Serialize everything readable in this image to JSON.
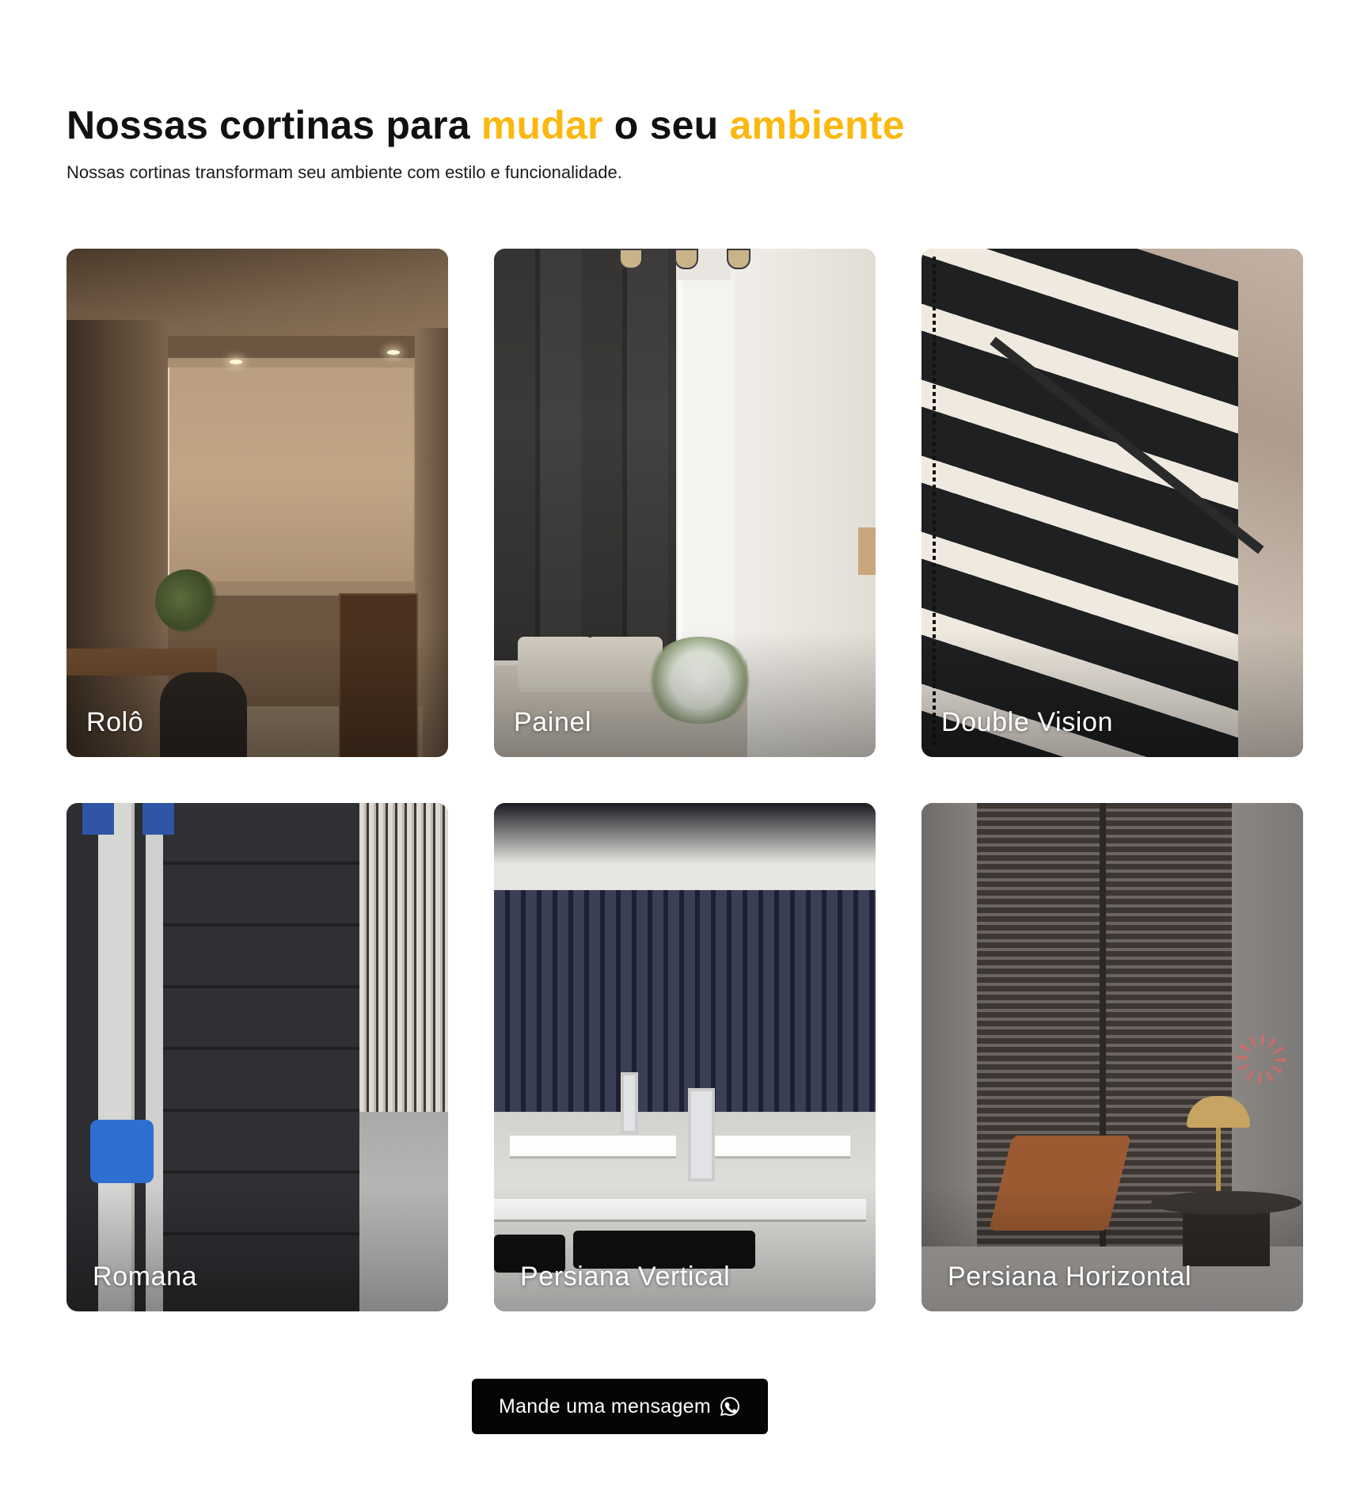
{
  "header": {
    "title_part1": "Nossas cortinas para ",
    "title_accent1": "mudar",
    "title_part2": " o seu ",
    "title_accent2": "ambiente",
    "subtitle": "Nossas cortinas transformam seu ambiente com estilo e funcionalidade."
  },
  "colors": {
    "accent": "#fbb80f",
    "text": "#111111",
    "button_bg": "#050505",
    "button_text": "#ffffff"
  },
  "products": [
    {
      "label": "Rolô",
      "image": "rolo-photo"
    },
    {
      "label": "Painel",
      "image": "painel-photo"
    },
    {
      "label": "Double Vision",
      "image": "double-vision-photo"
    },
    {
      "label": "Romana",
      "image": "romana-photo"
    },
    {
      "label": "Persiana Vertical",
      "image": "persiana-vertical-photo"
    },
    {
      "label": "Persiana Horizontal",
      "image": "persiana-horizontal-photo"
    }
  ],
  "cta": {
    "label": "Mande uma mensagem",
    "icon": "whatsapp-icon"
  }
}
